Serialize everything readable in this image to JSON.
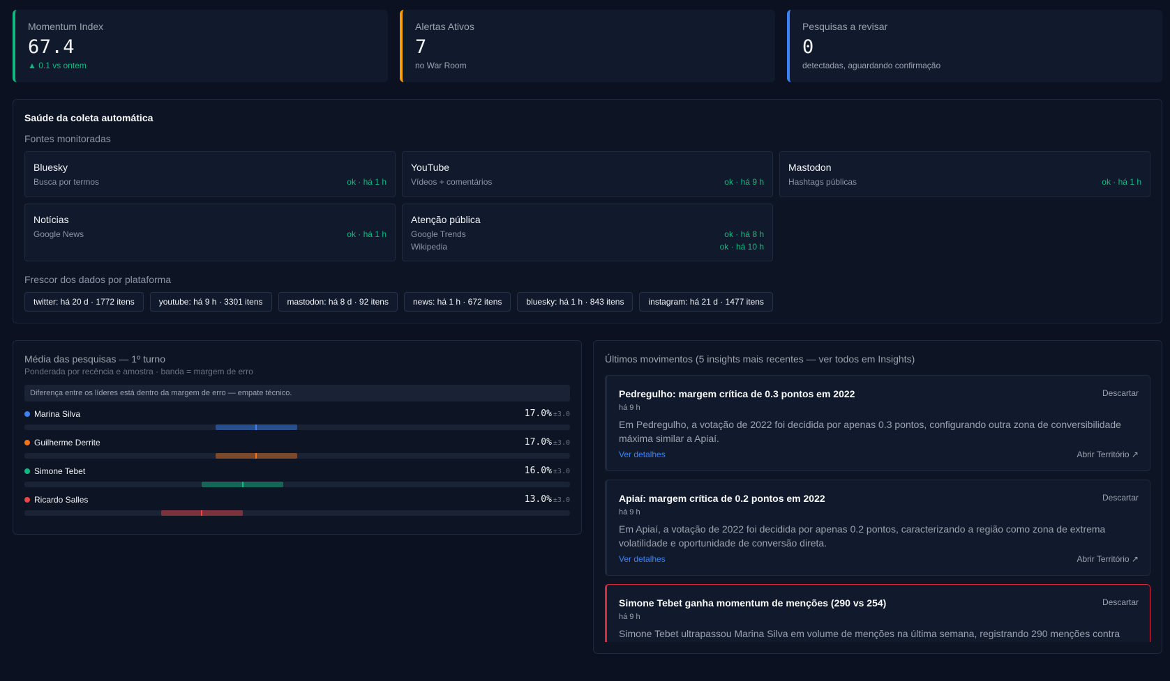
{
  "colors": {
    "bg": "#0b1120",
    "ok": "#10b981",
    "warn": "#f59e0b",
    "info": "#3b82f6",
    "alert": "#dc2a3a"
  },
  "kpis": [
    {
      "label": "Momentum Index",
      "value": "67.4",
      "sub": "▲ 0.1 vs ontem",
      "accent": "#10b981"
    },
    {
      "label": "Alertas Ativos",
      "value": "7",
      "sub": "no War Room",
      "accent": "#f59e0b"
    },
    {
      "label": "Pesquisas a revisar",
      "value": "0",
      "sub": "detectadas, aguardando confirmação",
      "accent": "#3b82f6"
    }
  ],
  "health": {
    "title": "Saúde da coleta automática",
    "sources_title": "Fontes monitoradas",
    "sources": [
      {
        "name": "Bluesky",
        "lines": [
          {
            "desc": "Busca por termos",
            "status": "ok · há 1 h"
          }
        ]
      },
      {
        "name": "YouTube",
        "lines": [
          {
            "desc": "Vídeos + comentários",
            "status": "ok · há 9 h"
          }
        ]
      },
      {
        "name": "Mastodon",
        "lines": [
          {
            "desc": "Hashtags públicas",
            "status": "ok · há 1 h"
          }
        ]
      },
      {
        "name": "Notícias",
        "lines": [
          {
            "desc": "Google News",
            "status": "ok · há 1 h"
          }
        ]
      },
      {
        "name": "Atenção pública",
        "lines": [
          {
            "desc": "Google Trends",
            "status": "ok · há 8 h"
          },
          {
            "desc": "Wikipedia",
            "status": "ok · há 10 h"
          }
        ]
      }
    ],
    "freshness_title": "Frescor dos dados por plataforma",
    "freshness": [
      "twitter: há 20 d · 1772 itens",
      "youtube: há 9 h · 3301 itens",
      "mastodon: há 8 d · 92 itens",
      "news: há 1 h · 672 itens",
      "bluesky: há 1 h · 843 itens",
      "instagram: há 21 d · 1477 itens"
    ]
  },
  "polls": {
    "title": "Média das pesquisas — 1º turno",
    "subtitle": "Ponderada por recência e amostra · banda = margem de erro",
    "notice": "Diferença entre os líderes está dentro da margem de erro — empate técnico.",
    "scale_max": 40,
    "candidates": [
      {
        "name": "Marina Silva",
        "value": 17.0,
        "display": "17.0%",
        "moe": 3.0,
        "moe_label": "±3.0",
        "color": "#3b82f6"
      },
      {
        "name": "Guilherme Derrite",
        "value": 17.0,
        "display": "17.0%",
        "moe": 3.0,
        "moe_label": "±3.0",
        "color": "#f97316"
      },
      {
        "name": "Simone Tebet",
        "value": 16.0,
        "display": "16.0%",
        "moe": 3.0,
        "moe_label": "±3.0",
        "color": "#10b981"
      },
      {
        "name": "Ricardo Salles",
        "value": 13.0,
        "display": "13.0%",
        "moe": 3.0,
        "moe_label": "±3.0",
        "color": "#ef4444"
      }
    ]
  },
  "insights": {
    "title": "Últimos movimentos (5 insights mais recentes — ver todos em Insights)",
    "dismiss_label": "Descartar",
    "details_label": "Ver detalhes",
    "open_label": "Abrir Território ↗",
    "items": [
      {
        "title": "Pedregulho: margem crítica de 0.3 pontos em 2022",
        "time": "há 9 h",
        "body": "Em Pedregulho, a votação de 2022 foi decidida por apenas 0.3 pontos, configurando outra zona de conversibilidade máxima similar a Apiaí."
      },
      {
        "title": "Apiaí: margem crítica de 0.2 pontos em 2022",
        "time": "há 9 h",
        "body": "Em Apiaí, a votação de 2022 foi decidida por apenas 0.2 pontos, caracterizando a região como zona de extrema volatilidade e oportunidade de conversão direta."
      },
      {
        "title": "Simone Tebet ganha momentum de menções (290 vs 254)",
        "time": "há 9 h",
        "body": "Simone Tebet ultrapassou Marina Silva em volume de menções na última semana, registrando 290 menções contra"
      }
    ]
  }
}
